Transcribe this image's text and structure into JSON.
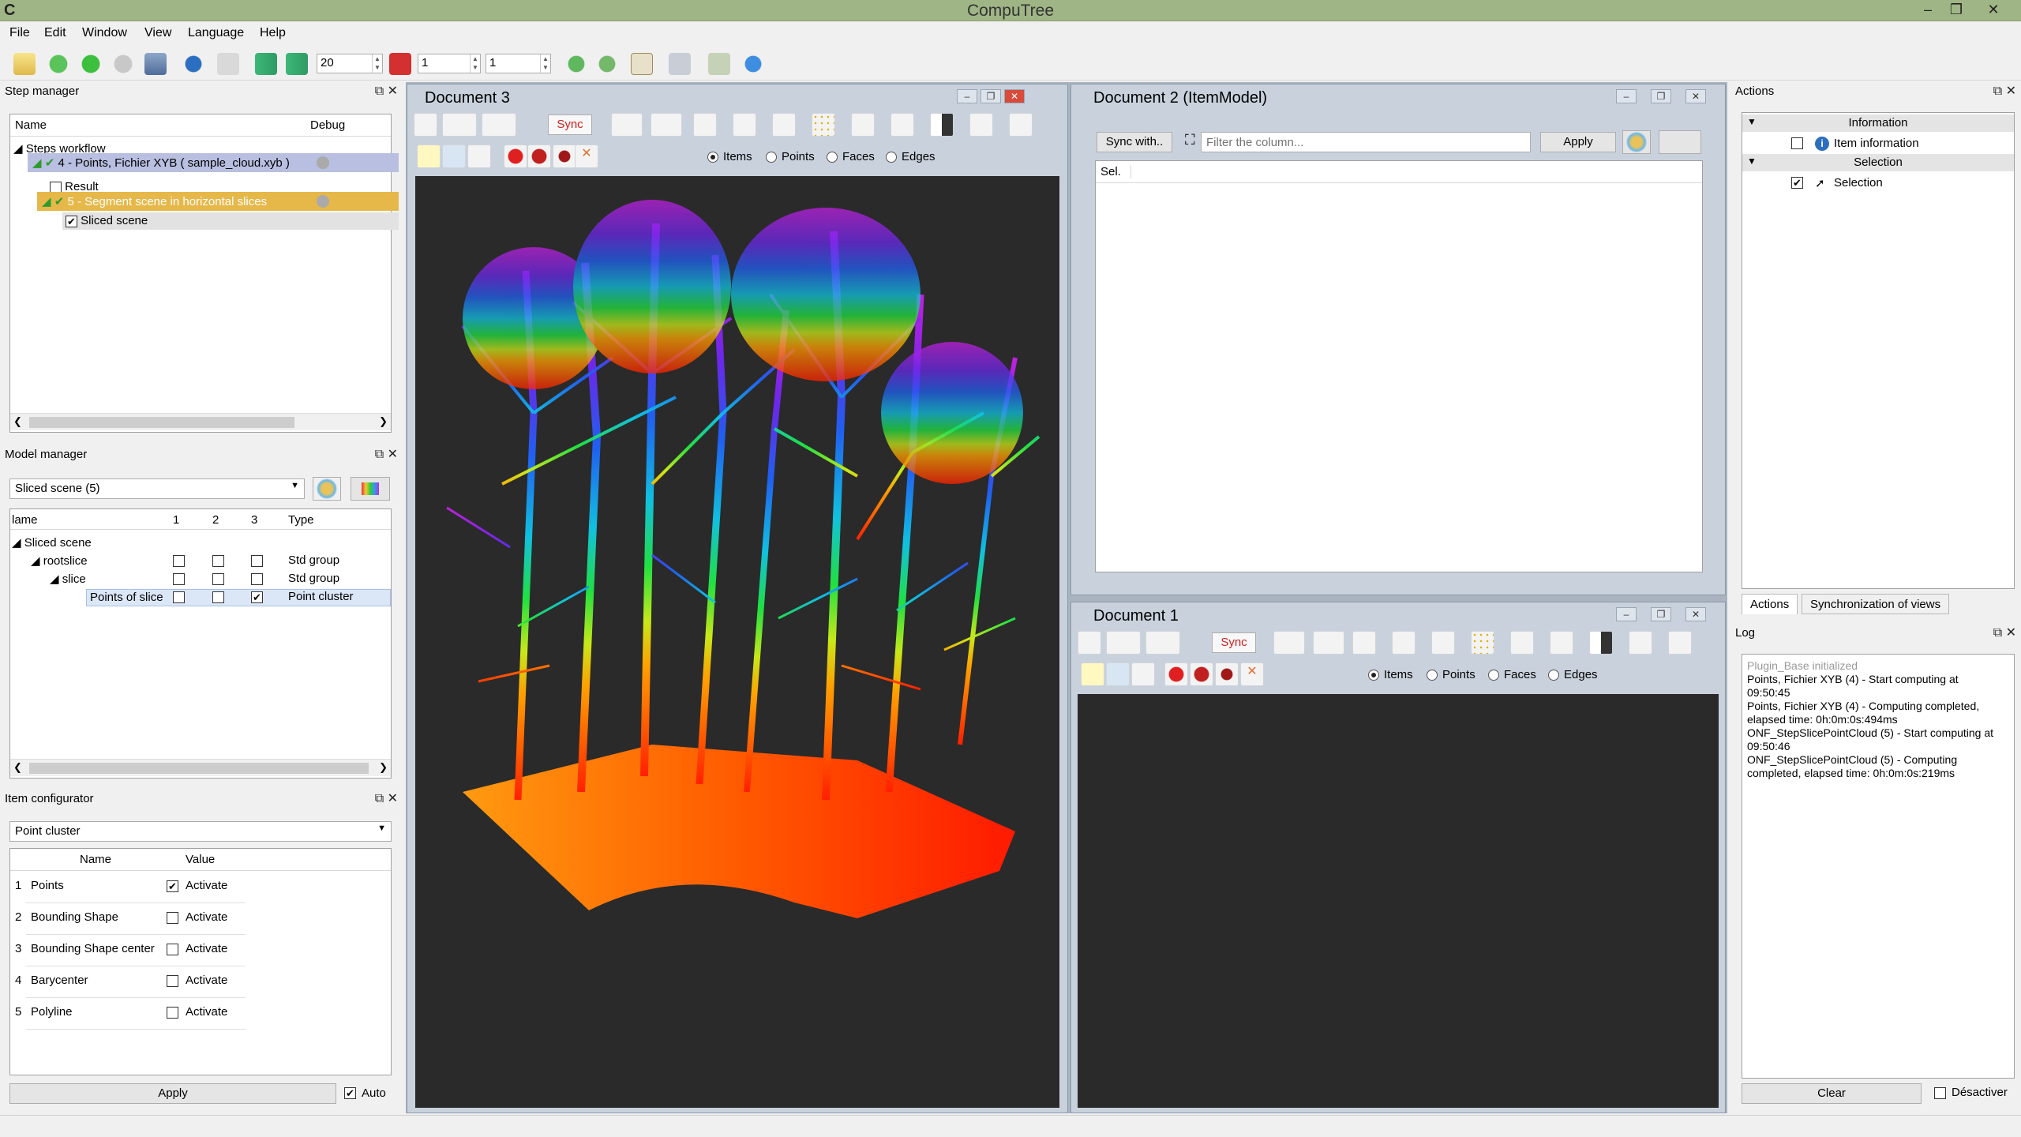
{
  "window": {
    "title": "CompuTree",
    "minimize": "–",
    "maximize": "❐",
    "close": "✕"
  },
  "menu": [
    "File",
    "Edit",
    "Window",
    "View",
    "Language",
    "Help"
  ],
  "toolbar": {
    "spin1": "20",
    "spin2": "1",
    "spin3": "1"
  },
  "step_manager": {
    "title": "Step manager",
    "col_name": "Name",
    "col_debug": "Debug",
    "tree": {
      "root": "Steps workflow",
      "step4": "4 - Points, Fichier XYB ( sample_cloud.xyb )",
      "result": "Result",
      "step5": "5 - Segment scene in horizontal slices",
      "sliced": "Sliced scene"
    }
  },
  "model_manager": {
    "title": "Model manager",
    "combo": "Sliced scene (5)",
    "cols": [
      "lame",
      "1",
      "2",
      "3",
      "Type"
    ],
    "rows": [
      {
        "name": "Sliced scene",
        "type": ""
      },
      {
        "name": "rootslice",
        "type": "Std group"
      },
      {
        "name": "slice",
        "type": "Std group"
      },
      {
        "name": "Points of slice",
        "type": "Point cluster"
      }
    ]
  },
  "item_configurator": {
    "title": "Item configurator",
    "combo": "Point cluster",
    "col_name": "Name",
    "col_value": "Value",
    "rows": [
      {
        "num": "1",
        "name": "Points",
        "value": "Activate",
        "checked": true
      },
      {
        "num": "2",
        "name": "Bounding Shape",
        "value": "Activate",
        "checked": false
      },
      {
        "num": "3",
        "name": "Bounding Shape center",
        "value": "Activate",
        "checked": false
      },
      {
        "num": "4",
        "name": "Barycenter",
        "value": "Activate",
        "checked": false
      },
      {
        "num": "5",
        "name": "Polyline",
        "value": "Activate",
        "checked": false
      }
    ],
    "apply": "Apply",
    "auto": "Auto"
  },
  "doc3": {
    "title": "Document 3",
    "sync": "Sync",
    "items": "Items",
    "points": "Points",
    "faces": "Faces",
    "edges": "Edges"
  },
  "doc2": {
    "title": "Document 2 (ItemModel)",
    "sync_with": "Sync with..",
    "filter_placeholder": "Filter the column...",
    "apply": "Apply",
    "col_sel": "Sel."
  },
  "doc1": {
    "title": "Document 1",
    "sync": "Sync",
    "items": "Items",
    "points": "Points",
    "faces": "Faces",
    "edges": "Edges"
  },
  "actions": {
    "title": "Actions",
    "information": "Information",
    "item_information": "Item information",
    "selection_header": "Selection",
    "selection": "Selection",
    "tab_actions": "Actions",
    "tab_sync": "Synchronization of views"
  },
  "log": {
    "title": "Log",
    "lines": [
      "Plugin_Base initialized",
      "Points, Fichier XYB (4) - Start computing at",
      "09:50:45",
      "Points, Fichier XYB (4) - Computing completed,",
      "elapsed time: 0h:0m:0s:494ms",
      "ONF_StepSlicePointCloud (5) - Start computing at",
      "09:50:46",
      "ONF_StepSlicePointCloud (5) - Computing",
      "completed, elapsed time: 0h:0m:0s:219ms"
    ],
    "clear": "Clear",
    "desactiver": "Désactiver"
  },
  "colors": {
    "titlebar": "#9fb585",
    "viewport": "#2a2a2a",
    "step_selected": "#b8bfe0",
    "step_running": "#e6b84a"
  }
}
